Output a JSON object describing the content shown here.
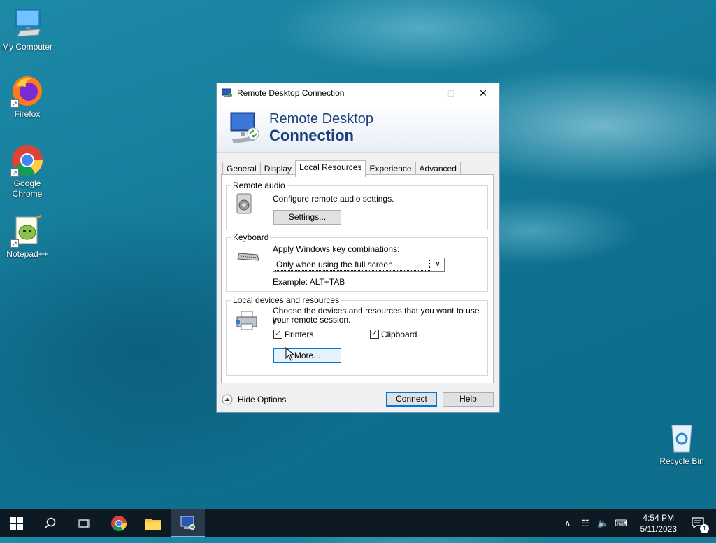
{
  "desktop": {
    "icons": [
      {
        "label": "My Computer"
      },
      {
        "label": "Firefox"
      },
      {
        "label": "Google Chrome"
      },
      {
        "label": "Notepad++"
      },
      {
        "label": "Recycle Bin"
      }
    ]
  },
  "dialog": {
    "title": "Remote Desktop Connection",
    "banner_line1": "Remote Desktop",
    "banner_line2": "Connection",
    "tabs": [
      "General",
      "Display",
      "Local Resources",
      "Experience",
      "Advanced"
    ],
    "active_tab": "Local Resources",
    "remote_audio": {
      "group_label": "Remote audio",
      "description": "Configure remote audio settings.",
      "settings_button": "Settings..."
    },
    "keyboard": {
      "group_label": "Keyboard",
      "description": "Apply Windows key combinations:",
      "selected_option": "Only when using the full screen",
      "example": "Example: ALT+TAB"
    },
    "local_devices": {
      "group_label": "Local devices and resources",
      "description_line1": "Choose the devices and resources that you want to use in",
      "description_line2": "your remote session.",
      "printers_label": "Printers",
      "printers_checked": true,
      "clipboard_label": "Clipboard",
      "clipboard_checked": true,
      "more_button": "More..."
    },
    "hide_options": "Hide Options",
    "connect_button": "Connect",
    "help_button": "Help"
  },
  "taskbar": {
    "time": "4:54 PM",
    "date": "5/11/2023",
    "notification_count": "1"
  },
  "colors": {
    "accent": "#0078d7",
    "banner_text": "#1b3f7a",
    "taskbar": "#0d1a24"
  }
}
